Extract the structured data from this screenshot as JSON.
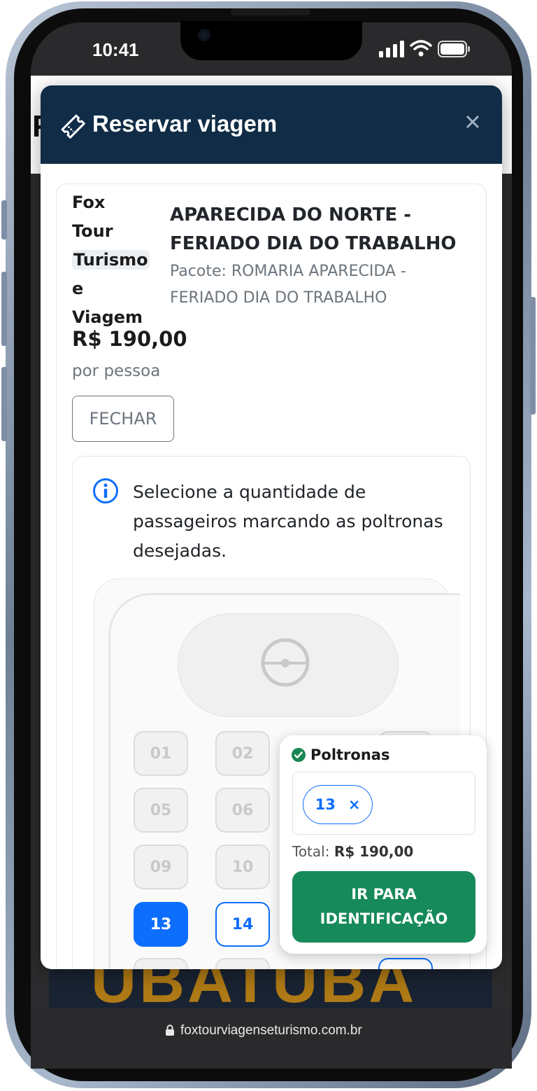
{
  "status_bar": {
    "time": "10:41"
  },
  "browser": {
    "url": "foxtourviagenseturismo.com.br"
  },
  "page": {
    "heading_partial": "F",
    "promo_text": "UBATUBA"
  },
  "modal": {
    "title": "Reservar viagem",
    "company": [
      "Fox",
      "Tour",
      "Turismo",
      "e",
      "Viagem"
    ],
    "trip_title": "APARECIDA DO NORTE - FERIADO DIA DO TRABALHO",
    "package": "Pacote: ROMARIA APARECIDA - FERIADO DIA DO TRABALHO",
    "price": "R$ 190,00",
    "price_unit": "por pessoa",
    "close_label": "FECHAR",
    "info_text": "Selecione a quantidade de passageiros marcando as poltronas desejadas.",
    "seats": [
      {
        "label": "01",
        "state": "occupied"
      },
      {
        "label": "02",
        "state": "occupied"
      },
      {
        "label": "05",
        "state": "occupied"
      },
      {
        "label": "06",
        "state": "occupied"
      },
      {
        "label": "09",
        "state": "occupied"
      },
      {
        "label": "10",
        "state": "occupied"
      },
      {
        "label": "13",
        "state": "selected"
      },
      {
        "label": "14",
        "state": "available"
      }
    ]
  },
  "summary": {
    "title": "Poltronas",
    "selected_seat": "13",
    "remove_symbol": "×",
    "total_label": "Total:",
    "total_value": "R$ 190,00",
    "next_button": "IR PARA IDENTIFICAÇÃO"
  },
  "colors": {
    "header": "#112c46",
    "accent": "#0d6efd",
    "success": "#168a5a"
  }
}
